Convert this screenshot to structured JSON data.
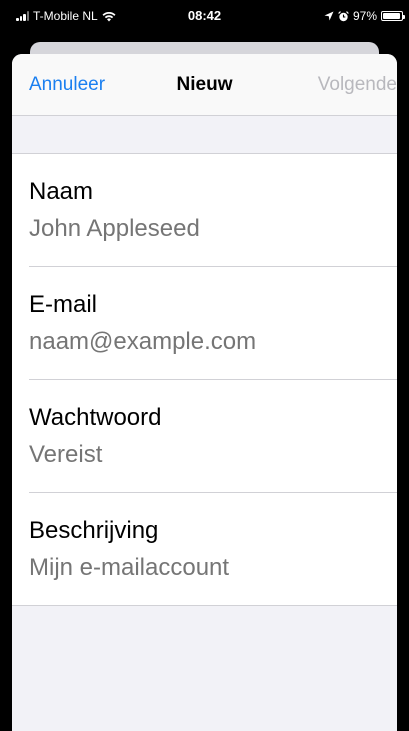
{
  "status_bar": {
    "carrier": "T-Mobile NL",
    "time": "08:42",
    "battery": "97%",
    "battery_level": 0.97,
    "icons": [
      "cellular-signal-icon",
      "wifi-icon",
      "location-arrow-icon",
      "alarm-clock-icon",
      "battery-icon"
    ]
  },
  "nav": {
    "cancel_label": "Annuleer",
    "title": "Nieuw",
    "next_label": "Volgende"
  },
  "form": {
    "fields": [
      {
        "label": "Naam",
        "placeholder": "John Appleseed"
      },
      {
        "label": "E-mail",
        "placeholder": "naam@example.com"
      },
      {
        "label": "Wachtwoord",
        "placeholder": "Vereist"
      },
      {
        "label": "Beschrijving",
        "placeholder": "Mijn e-mailaccount"
      }
    ]
  },
  "colors": {
    "accent": "#1a7ff0",
    "disabled": "#b8b8bd",
    "placeholder": "#c4c4c9",
    "grouped_background": "#f2f2f7"
  }
}
